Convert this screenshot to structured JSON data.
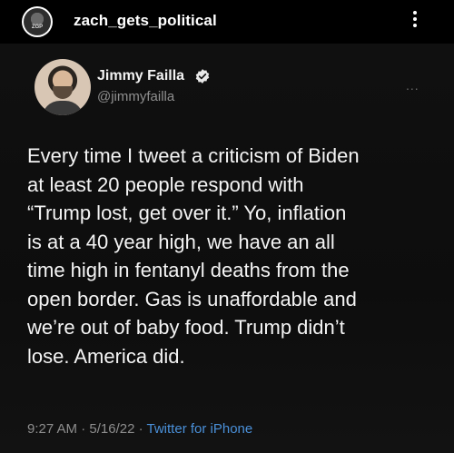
{
  "instagram": {
    "username": "zach_gets_political",
    "avatar_text": "ZGP",
    "more_icon": "vertical-dots-icon"
  },
  "tweet": {
    "display_name": "Jimmy Failla",
    "handle": "@jimmyfailla",
    "verified_icon": "verified-badge-icon",
    "more_icon": "horizontal-dots-icon",
    "more_text": "...",
    "lines": [
      "Every time I tweet a criticism of Biden",
      "at least 20 people respond with",
      "“Trump lost, get over it.” Yo, inflation",
      "is at a 40 year high, we have an all",
      "time high in fentanyl deaths from the",
      "open border. Gas is unaffordable and",
      "we’re out of baby food. Trump didn’t",
      "lose. America did."
    ],
    "time": "9:27 AM",
    "separator": "·",
    "date": "5/16/22",
    "source": "Twitter for iPhone"
  },
  "colors": {
    "background": "#000000",
    "text": "#f4f4f4",
    "secondary_text": "#8e8e8e",
    "link": "#4a90d9",
    "verified": "#1d9bf0"
  }
}
